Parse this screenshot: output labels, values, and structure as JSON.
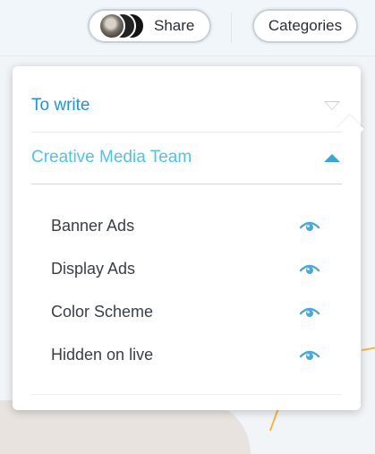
{
  "header": {
    "share_label": "Share",
    "categories_label": "Categories"
  },
  "dropdown": {
    "sections": [
      {
        "label": "To write",
        "state": "collapsed",
        "icon": "chevron-down-icon"
      },
      {
        "label": "Creative Media Team",
        "state": "expanded",
        "icon": "chevron-up-icon"
      }
    ],
    "items": [
      {
        "label": "Banner Ads",
        "icon": "eye-icon"
      },
      {
        "label": "Display Ads",
        "icon": "eye-icon"
      },
      {
        "label": "Color Scheme",
        "icon": "eye-icon"
      },
      {
        "label": "Hidden on live",
        "icon": "eye-icon"
      }
    ]
  },
  "colors": {
    "section_active": "#1c93e3",
    "section_expanded": "#4ec3ea",
    "eye_icon": "#4aa8e0"
  }
}
